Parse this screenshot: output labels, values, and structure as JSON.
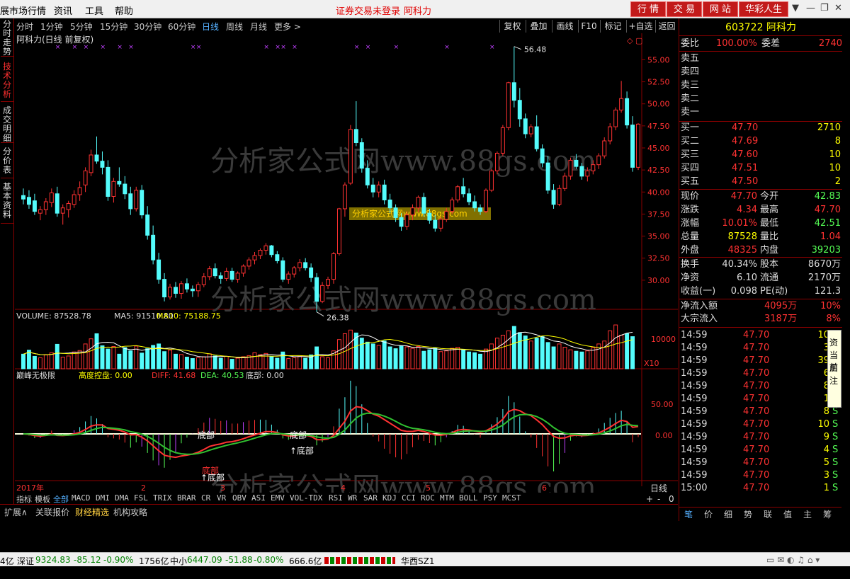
{
  "menu": {
    "left": [
      "展市场行情",
      "资讯",
      "工具",
      "帮助"
    ],
    "notice": "证券交易未登录",
    "stock_label": "阿科力",
    "right_buttons": [
      "行 情",
      "交 易",
      "网 站",
      "华彩人生"
    ]
  },
  "left_tabs": [
    "分时走势",
    "技术分析",
    "成交明细",
    "分价表",
    "基本资料"
  ],
  "period_tabs": [
    "分时",
    "1分钟",
    "5分钟",
    "15分钟",
    "30分钟",
    "60分钟",
    "日线",
    "周线",
    "月线",
    "更多 >"
  ],
  "tool_buttons": [
    "复权",
    "叠加",
    "画线",
    "F10",
    "标记",
    "+自选",
    "返回"
  ],
  "chart_data": {
    "type": "candlestick",
    "title": "阿科力(日线 前复权)",
    "price_ticks": [
      55.0,
      52.5,
      50.0,
      47.5,
      45.0,
      42.5,
      40.0,
      37.5,
      35.0,
      32.5,
      30.0
    ],
    "price_tick_labels": [
      "55.00",
      "52.50",
      "50.00",
      "47.50",
      "45.00",
      "42.50",
      "40.00",
      "37.50",
      "35.00",
      "32.50",
      "30.00"
    ],
    "max_label": "56.48",
    "min_label": "26.38",
    "ohlc": [
      [
        39.6,
        40.4,
        38.6,
        39.2
      ],
      [
        39.4,
        40.2,
        38.1,
        38.6
      ],
      [
        39.0,
        39.8,
        37.4,
        37.8
      ],
      [
        37.6,
        38.4,
        36.8,
        38.0
      ],
      [
        38.0,
        39.3,
        37.4,
        38.9
      ],
      [
        38.8,
        40.4,
        38.3,
        39.9
      ],
      [
        39.8,
        40.6,
        37.2,
        37.6
      ],
      [
        37.6,
        38.6,
        36.3,
        38.2
      ],
      [
        38.0,
        39.0,
        37.1,
        38.7
      ],
      [
        38.6,
        40.2,
        38.2,
        39.7
      ],
      [
        39.7,
        41.2,
        39.0,
        40.5
      ],
      [
        40.8,
        42.8,
        40.0,
        42.4
      ],
      [
        42.2,
        44.8,
        41.8,
        44.2
      ],
      [
        44.2,
        46.3,
        43.2,
        43.5
      ],
      [
        43.5,
        44.6,
        42.0,
        42.8
      ],
      [
        42.8,
        43.6,
        39.0,
        39.5
      ],
      [
        39.5,
        41.6,
        38.8,
        41.2
      ],
      [
        41.2,
        42.8,
        40.6,
        40.9
      ],
      [
        40.9,
        41.8,
        39.2,
        39.8
      ],
      [
        39.8,
        40.6,
        37.4,
        38.1
      ],
      [
        38.1,
        40.6,
        37.8,
        40.2
      ],
      [
        40.2,
        40.8,
        37.0,
        37.4
      ],
      [
        37.4,
        38.4,
        34.6,
        35.1
      ],
      [
        35.1,
        36.2,
        31.8,
        32.3
      ],
      [
        32.3,
        33.1,
        29.6,
        30.1
      ],
      [
        30.1,
        30.8,
        27.6,
        28.1
      ],
      [
        28.1,
        29.6,
        27.8,
        29.2
      ],
      [
        29.2,
        29.8,
        28.0,
        28.5
      ],
      [
        28.5,
        29.9,
        27.9,
        29.6
      ],
      [
        29.6,
        30.2,
        28.6,
        29.0
      ],
      [
        29.0,
        29.4,
        28.1,
        28.8
      ],
      [
        28.8,
        29.8,
        28.1,
        29.5
      ],
      [
        29.5,
        30.8,
        29.2,
        30.4
      ],
      [
        30.4,
        31.6,
        30.0,
        31.3
      ],
      [
        31.3,
        31.9,
        30.2,
        30.5
      ],
      [
        30.5,
        30.9,
        29.6,
        30.2
      ],
      [
        30.2,
        31.4,
        29.9,
        31.0
      ],
      [
        31.0,
        31.4,
        29.8,
        30.1
      ],
      [
        30.1,
        31.0,
        29.7,
        30.8
      ],
      [
        30.8,
        31.8,
        30.4,
        31.6
      ],
      [
        31.6,
        32.6,
        31.2,
        32.3
      ],
      [
        32.3,
        33.2,
        31.8,
        32.8
      ],
      [
        32.8,
        33.6,
        32.4,
        33.4
      ],
      [
        33.4,
        34.2,
        32.9,
        33.9
      ],
      [
        33.9,
        34.0,
        32.6,
        32.9
      ],
      [
        32.9,
        33.3,
        31.9,
        32.2
      ],
      [
        32.2,
        32.6,
        29.8,
        30.1
      ],
      [
        30.1,
        31.0,
        29.6,
        30.7
      ],
      [
        30.7,
        31.6,
        30.3,
        31.4
      ],
      [
        31.4,
        32.4,
        31.0,
        32.0
      ],
      [
        32.0,
        32.5,
        31.1,
        31.4
      ],
      [
        31.4,
        31.9,
        29.8,
        30.3
      ],
      [
        30.3,
        30.8,
        26.4,
        27.6
      ],
      [
        27.6,
        29.8,
        27.4,
        29.4
      ],
      [
        29.4,
        30.4,
        29.0,
        30.1
      ],
      [
        30.1,
        33.2,
        29.6,
        33.0
      ],
      [
        33.0,
        38.2,
        32.8,
        38.1
      ],
      [
        38.1,
        41.1,
        37.2,
        40.8
      ],
      [
        41.0,
        47.6,
        40.8,
        47.1
      ],
      [
        47.1,
        50.3,
        45.2,
        45.6
      ],
      [
        45.6,
        46.1,
        42.2,
        42.7
      ],
      [
        42.7,
        43.6,
        40.4,
        40.8
      ],
      [
        40.8,
        41.6,
        39.4,
        40.0
      ],
      [
        40.0,
        41.2,
        39.4,
        40.8
      ],
      [
        40.8,
        41.4,
        38.6,
        39.1
      ],
      [
        39.1,
        39.8,
        37.6,
        38.2
      ],
      [
        38.2,
        38.6,
        36.6,
        37.1
      ],
      [
        37.1,
        37.6,
        35.6,
        36.1
      ],
      [
        36.1,
        37.8,
        35.7,
        37.4
      ],
      [
        37.4,
        38.6,
        36.8,
        38.2
      ],
      [
        38.2,
        39.6,
        37.7,
        39.4
      ],
      [
        39.4,
        39.9,
        37.2,
        37.6
      ],
      [
        37.6,
        38.1,
        36.4,
        36.8
      ],
      [
        36.8,
        37.4,
        35.5,
        35.9
      ],
      [
        35.9,
        37.2,
        35.5,
        36.9
      ],
      [
        36.9,
        38.2,
        36.6,
        37.8
      ],
      [
        37.8,
        39.4,
        37.5,
        39.1
      ],
      [
        39.1,
        40.8,
        38.8,
        40.6
      ],
      [
        40.6,
        41.6,
        39.4,
        39.8
      ],
      [
        39.8,
        40.4,
        38.5,
        38.9
      ],
      [
        38.9,
        39.6,
        37.8,
        38.2
      ],
      [
        38.2,
        38.6,
        37.4,
        37.8
      ],
      [
        37.8,
        40.4,
        37.6,
        40.2
      ],
      [
        40.2,
        42.6,
        40.0,
        42.4
      ],
      [
        42.4,
        44.6,
        42.0,
        44.4
      ],
      [
        44.4,
        47.6,
        44.1,
        47.3
      ],
      [
        47.3,
        52.5,
        47.0,
        52.4
      ],
      [
        52.4,
        56.5,
        49.6,
        50.4
      ],
      [
        50.4,
        51.8,
        47.4,
        48.3
      ],
      [
        48.3,
        48.9,
        46.1,
        46.6
      ],
      [
        46.6,
        47.7,
        46.2,
        47.4
      ],
      [
        47.4,
        48.7,
        44.6,
        44.9
      ],
      [
        44.9,
        45.4,
        42.8,
        43.3
      ],
      [
        43.3,
        44.1,
        39.8,
        40.2
      ],
      [
        40.2,
        40.9,
        38.1,
        38.6
      ],
      [
        38.6,
        40.8,
        38.4,
        40.4
      ],
      [
        40.4,
        42.2,
        40.1,
        41.8
      ],
      [
        41.8,
        43.9,
        41.4,
        43.6
      ],
      [
        43.6,
        44.3,
        42.6,
        42.9
      ],
      [
        42.9,
        43.3,
        41.4,
        41.8
      ],
      [
        41.8,
        42.8,
        41.2,
        42.4
      ],
      [
        42.4,
        43.6,
        42.0,
        43.1
      ],
      [
        43.1,
        44.4,
        42.6,
        44.1
      ],
      [
        44.1,
        46.2,
        43.8,
        45.8
      ],
      [
        45.8,
        47.8,
        45.4,
        47.4
      ],
      [
        47.4,
        49.6,
        47.0,
        49.3
      ],
      [
        49.3,
        52.6,
        49.0,
        50.6
      ],
      [
        50.6,
        51.4,
        47.2,
        47.6
      ],
      [
        47.6,
        48.6,
        42.3,
        42.8
      ],
      [
        42.8,
        47.8,
        42.5,
        47.7
      ]
    ],
    "volume": {
      "label": "VOLUME",
      "value": "87528.78",
      "ma5_label": "MA5",
      "ma5": "91510.80",
      "ma10_label": "MA10",
      "ma10": "75188.75",
      "tick": "10000",
      "unit": "X10",
      "values": [
        4.0,
        5.1,
        3.4,
        3.0,
        3.8,
        4.4,
        6.7,
        3.2,
        3.5,
        4.6,
        5.0,
        6.8,
        8.2,
        9.6,
        6.3,
        5.4,
        6.1,
        4.0,
        5.8,
        4.9,
        6.2,
        4.3,
        5.5,
        6.4,
        6.8,
        4.7,
        5.1,
        4.0,
        3.9,
        3.2,
        2.8,
        3.0,
        3.3,
        4.1,
        3.5,
        2.9,
        3.4,
        2.6,
        2.9,
        3.3,
        3.6,
        4.4,
        3.9,
        4.2,
        3.3,
        2.9,
        4.6,
        2.8,
        3.0,
        3.4,
        2.9,
        3.8,
        6.0,
        3.3,
        3.0,
        4.9,
        8.0,
        9.6,
        10.6,
        9.8,
        8.4,
        7.3,
        6.8,
        6.4,
        7.6,
        6.0,
        5.5,
        6.3,
        6.0,
        5.6,
        6.1,
        4.8,
        5.2,
        5.6,
        4.7,
        4.9,
        5.6,
        5.9,
        5.1,
        4.6,
        4.4,
        4.0,
        5.4,
        6.8,
        8.4,
        9.2,
        10.4,
        11.6,
        9.9,
        9.0,
        7.6,
        8.4,
        8.8,
        7.2,
        6.0,
        6.8,
        5.9,
        5.2,
        4.8,
        4.6,
        4.9,
        5.8,
        6.8,
        7.6,
        10.4,
        12.0,
        9.2,
        9.6,
        8.8
      ]
    },
    "indicator": {
      "name": "巅峰无极限",
      "items": [
        {
          "label": "高度控盘:",
          "value": "0.00"
        },
        {
          "label": "DIFF:",
          "value": "41.68"
        },
        {
          "label": "DEA:",
          "value": "40.53"
        },
        {
          "label": "底部:",
          "value": "0.00"
        }
      ],
      "ticks": [
        "50.00",
        "0.00"
      ],
      "bottom_labels": [
        "底部",
        "底部",
        "↑底部",
        "↑底部",
        "底部"
      ]
    },
    "x_labels": [
      "2017年",
      "2",
      "3",
      "4",
      "5",
      "6"
    ],
    "watermark": "分析家公式网www.88gs.com"
  },
  "indicator_tabs": [
    "指标",
    "模板",
    "全部",
    "MACD",
    "DMI",
    "DMA",
    "FSL",
    "TRIX",
    "BRAR",
    "CR",
    "VR",
    "OBV",
    "ASI",
    "EMV",
    "VOL-TDX",
    "RSI",
    "WR",
    "SAR",
    "KDJ",
    "CCI",
    "ROC",
    "MTM",
    "BOLL",
    "PSY",
    "MCST"
  ],
  "period_label": "日线",
  "bottom_tabs": [
    "扩展∧",
    "关联报价",
    "财经精选",
    "机构攻略"
  ],
  "quote": {
    "code_name": "603722 阿科力",
    "weibi": {
      "l1": "委比",
      "v1": "100.00%",
      "l2": "委差",
      "v2": "2740"
    },
    "sell": [
      {
        "l": "卖五",
        "p": "",
        "v": ""
      },
      {
        "l": "卖四",
        "p": "",
        "v": ""
      },
      {
        "l": "卖三",
        "p": "",
        "v": ""
      },
      {
        "l": "卖二",
        "p": "",
        "v": ""
      },
      {
        "l": "卖一",
        "p": "",
        "v": ""
      }
    ],
    "buy": [
      {
        "l": "买一",
        "p": "47.70",
        "v": "2710"
      },
      {
        "l": "买二",
        "p": "47.69",
        "v": "8"
      },
      {
        "l": "买三",
        "p": "47.60",
        "v": "10"
      },
      {
        "l": "买四",
        "p": "47.51",
        "v": "10"
      },
      {
        "l": "买五",
        "p": "47.50",
        "v": "2"
      }
    ],
    "stats": [
      {
        "l1": "现价",
        "v1": "47.70",
        "l2": "今开",
        "v2": "42.83"
      },
      {
        "l1": "涨跌",
        "v1": "4.34",
        "l2": "最高",
        "v2": "47.70"
      },
      {
        "l1": "涨幅",
        "v1": "10.01%",
        "l2": "最低",
        "v2": "42.51"
      },
      {
        "l1": "总量",
        "v1": "87528",
        "l2": "量比",
        "v2": "1.04"
      },
      {
        "l1": "外盘",
        "v1": "48325",
        "l2": "内盘",
        "v2": "39203"
      }
    ],
    "stats2": [
      {
        "l1": "换手",
        "v1": "40.34%",
        "l2": "股本",
        "v2": "8670万"
      },
      {
        "l1": "净资",
        "v1": "6.10",
        "l2": "流通",
        "v2": "2170万"
      },
      {
        "l1": "收益(一)",
        "v1": "0.098",
        "l2": "PE(动)",
        "v2": "121.3"
      }
    ],
    "flow": [
      {
        "l": "净流入额",
        "v": "4095万",
        "p": "10%"
      },
      {
        "l": "大宗流入",
        "v": "3187万",
        "p": "8%"
      }
    ],
    "ticks": [
      {
        "t": "14:59",
        "p": "47.70",
        "v": "10",
        "s": ""
      },
      {
        "t": "14:59",
        "p": "47.70",
        "v": "3",
        "s": ""
      },
      {
        "t": "14:59",
        "p": "47.70",
        "v": "39",
        "s": ""
      },
      {
        "t": "14:59",
        "p": "47.70",
        "v": "6",
        "s": ""
      },
      {
        "t": "14:59",
        "p": "47.70",
        "v": "8",
        "s": ""
      },
      {
        "t": "14:59",
        "p": "47.70",
        "v": "1",
        "s": ""
      },
      {
        "t": "14:59",
        "p": "47.70",
        "v": "8",
        "s": "S"
      },
      {
        "t": "14:59",
        "p": "47.70",
        "v": "10",
        "s": "S"
      },
      {
        "t": "14:59",
        "p": "47.70",
        "v": "9",
        "s": "S"
      },
      {
        "t": "14:59",
        "p": "47.70",
        "v": "4",
        "s": "S"
      },
      {
        "t": "14:59",
        "p": "47.70",
        "v": "5",
        "s": "S"
      },
      {
        "t": "14:59",
        "p": "47.70",
        "v": "3",
        "s": "S"
      },
      {
        "t": "15:00",
        "p": "47.70",
        "v": "1",
        "s": "S"
      }
    ],
    "bottom_tabs": [
      "笔",
      "价",
      "细",
      "势",
      "联",
      "值",
      "主",
      "筹"
    ],
    "popup": [
      "资",
      "当前",
      "启",
      "注"
    ]
  },
  "status": {
    "s0": "4亿",
    "s1": "深证",
    "s2": "9324.83",
    "s3": "-85.12",
    "s4": "-0.90%",
    "s5": "1756亿",
    "s6": "中小",
    "s7": "6447.09",
    "s8": "-51.88",
    "s9": "-0.80%",
    "s10": "666.6亿",
    "s11": "华西SZ1"
  },
  "colors": {
    "up": "#ff3232",
    "down": "#54fcfc",
    "ma5": "#ffffff",
    "ma10": "#ffff00"
  }
}
